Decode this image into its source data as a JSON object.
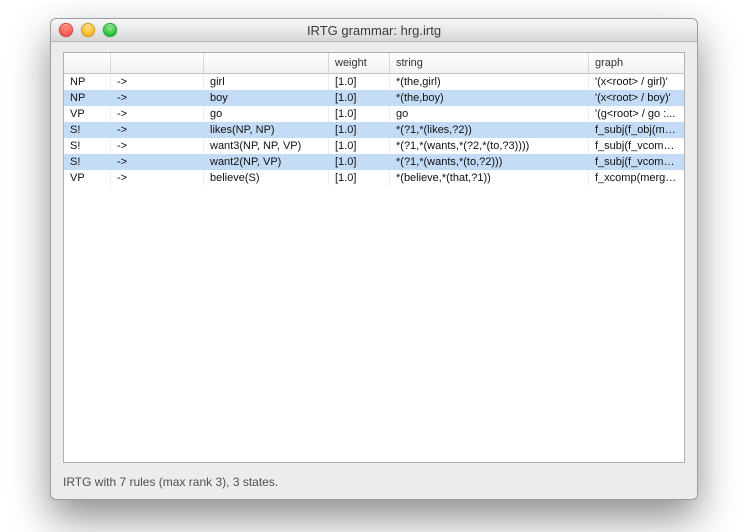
{
  "window": {
    "title": "IRTG grammar: hrg.irtg"
  },
  "columns": [
    "",
    "",
    "",
    "weight",
    "string",
    "graph"
  ],
  "rows": [
    {
      "sel": false,
      "c0": "NP",
      "c1": "->",
      "c2": "girl",
      "c3": "[1.0]",
      "c4": "*(the,girl)",
      "c5": "'(x<root> / girl)'"
    },
    {
      "sel": true,
      "c0": "NP",
      "c1": "->",
      "c2": "boy",
      "c3": "[1.0]",
      "c4": "*(the,boy)",
      "c5": "'(x<root> / boy)'"
    },
    {
      "sel": false,
      "c0": "VP",
      "c1": "->",
      "c2": "go",
      "c3": "[1.0]",
      "c4": "go",
      "c5": "'(g<root> / go  :..."
    },
    {
      "sel": true,
      "c0": "S!",
      "c1": "->",
      "c2": "likes(NP, NP)",
      "c3": "[1.0]",
      "c4": "*(?1,*(likes,?2))",
      "c5": "f_subj(f_obj(mer..."
    },
    {
      "sel": false,
      "c0": "S!",
      "c1": "->",
      "c2": "want3(NP, NP, VP)",
      "c3": "[1.0]",
      "c4": "*(?1,*(wants,*(?2,*(to,?3))))",
      "c5": "f_subj(f_vcomp(..."
    },
    {
      "sel": true,
      "c0": "S!",
      "c1": "->",
      "c2": "want2(NP, VP)",
      "c3": "[1.0]",
      "c4": "*(?1,*(wants,*(to,?2)))",
      "c5": "f_subj(f_vcomp(..."
    },
    {
      "sel": false,
      "c0": "VP",
      "c1": "->",
      "c2": "believe(S)",
      "c3": "[1.0]",
      "c4": "*(believe,*(that,?1))",
      "c5": "f_xcomp(merge('..."
    }
  ],
  "status": "IRTG with 7 rules (max rank 3), 3 states."
}
